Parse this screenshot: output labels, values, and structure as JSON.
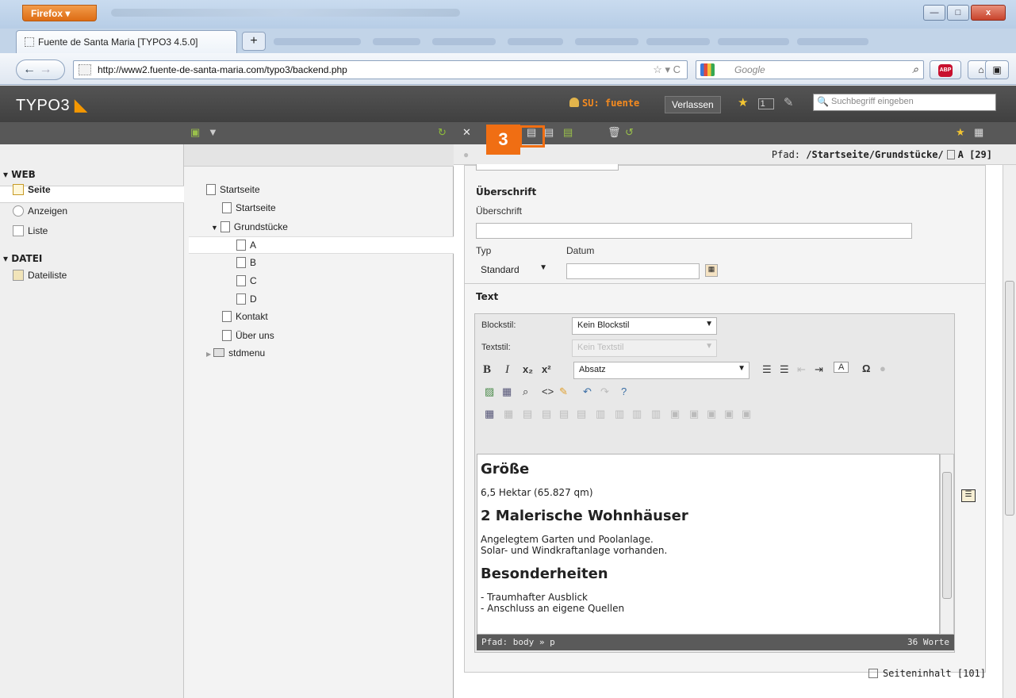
{
  "browser": {
    "menu_button": "Firefox",
    "tab_title": "Fuente de Santa Maria [TYPO3 4.5.0]",
    "new_tab_label": "+",
    "url": "http://www2.fuente-de-santa-maria.com/typo3/backend.php",
    "search_placeholder": "Google"
  },
  "topbar": {
    "logo_text": "TYPO3",
    "user_label": "SU: fuente",
    "exit_button": "Verlassen",
    "workspace_count": "1",
    "search_placeholder": "Suchbegriff eingeben"
  },
  "badge": {
    "number": "3"
  },
  "modules": {
    "groups": [
      {
        "label": "▾ WEB",
        "items": [
          "Seite",
          "Anzeigen",
          "Liste"
        ]
      },
      {
        "label": "▾ DATEI",
        "items": [
          "Dateiliste"
        ]
      }
    ]
  },
  "tree": {
    "nodes": [
      "Startseite",
      "Startseite",
      "Grundstücke",
      "A",
      "B",
      "C",
      "D",
      "Kontakt",
      "Über uns",
      "stdmenu"
    ]
  },
  "path": {
    "label": "Pfad:",
    "value": "/Startseite/Grundstücke/",
    "page": "A [29]"
  },
  "form": {
    "header_section": "Überschrift",
    "header_label": "Überschrift",
    "header_value": "",
    "type_label": "Typ",
    "type_value": "Standard",
    "date_label": "Datum",
    "date_value": "",
    "text_section": "Text"
  },
  "rte": {
    "blockstyle_label": "Blockstil:",
    "blockstyle_value": "Kein Blockstil",
    "textstyle_label": "Textstil:",
    "textstyle_value": "Kein Textstil",
    "format_value": "Absatz",
    "content": {
      "h1": "Größe",
      "p1": "6,5 Hektar (65.827 qm)",
      "h2": "2 Malerische Wohnhäuser",
      "p2a": "Angelegtem Garten und Poolanlage.",
      "p2b": "Solar- und Windkraftanlage vorhanden.",
      "h3": "Besonderheiten",
      "l1": "- Traumhafter Ausblick",
      "l2": "- Anschluss an eigene Quellen"
    },
    "status_path": "Pfad:  body » p",
    "word_count": "36 Worte"
  },
  "footer": {
    "content_element": "Seiteninhalt [101]"
  }
}
